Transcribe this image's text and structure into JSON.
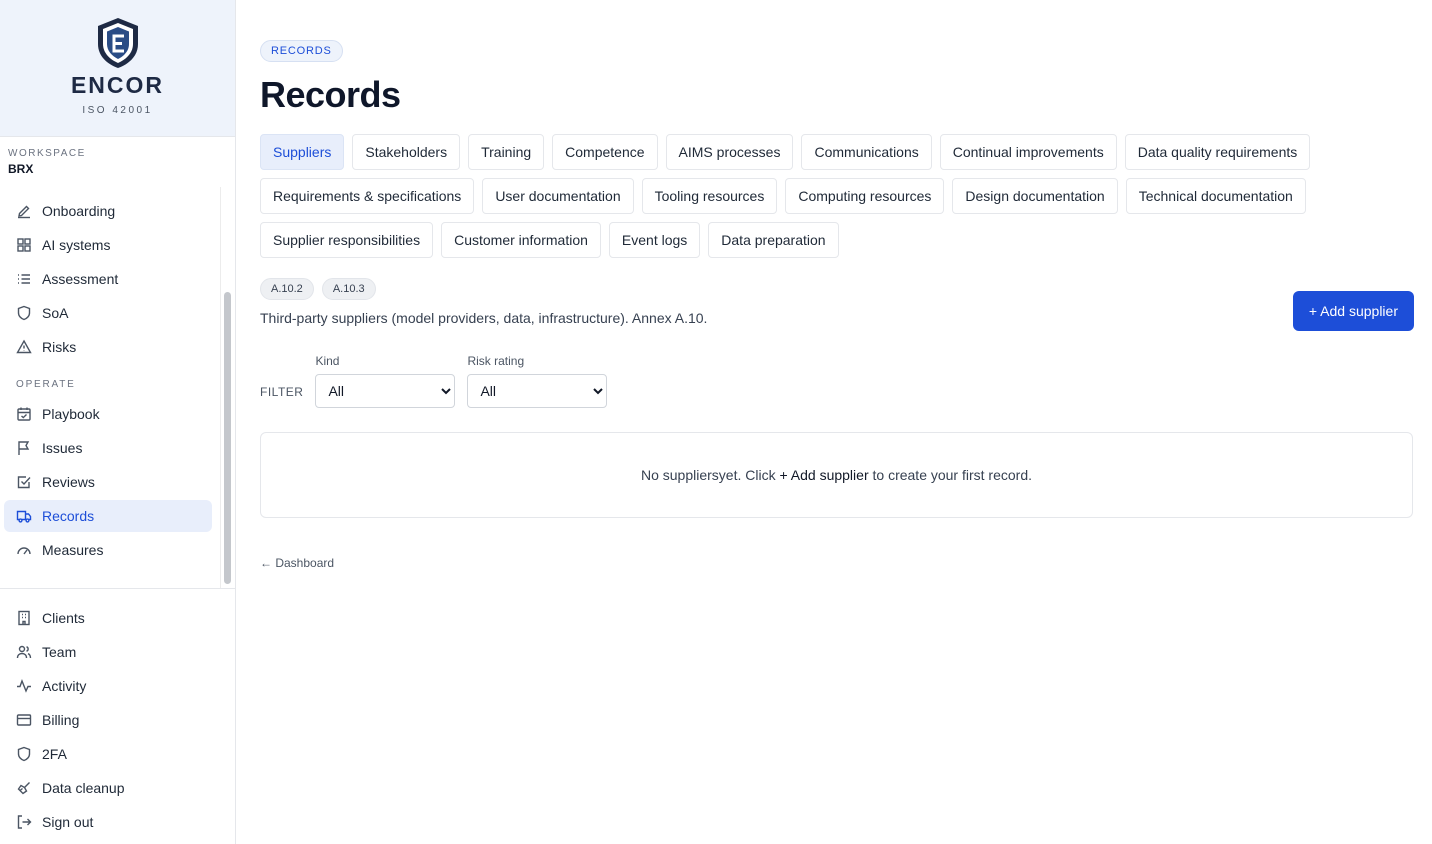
{
  "brand": {
    "name": "ENCOR",
    "subtitle": "ISO 42001"
  },
  "workspace": {
    "label": "WORKSPACE",
    "value": "BRX"
  },
  "sidebar": {
    "main_items": [
      {
        "label": "Onboarding",
        "icon": "pen-icon"
      },
      {
        "label": "AI systems",
        "icon": "grid-icon"
      },
      {
        "label": "Assessment",
        "icon": "list-icon"
      },
      {
        "label": "SoA",
        "icon": "shield-icon"
      },
      {
        "label": "Risks",
        "icon": "warning-icon"
      }
    ],
    "operate_label": "OPERATE",
    "operate_items": [
      {
        "label": "Playbook",
        "icon": "calendar-check-icon"
      },
      {
        "label": "Issues",
        "icon": "flag-icon"
      },
      {
        "label": "Reviews",
        "icon": "checkbox-icon"
      },
      {
        "label": "Records",
        "icon": "truck-icon",
        "active": true
      },
      {
        "label": "Measures",
        "icon": "gauge-icon"
      }
    ],
    "bottom_items": [
      {
        "label": "Clients",
        "icon": "building-icon"
      },
      {
        "label": "Team",
        "icon": "users-icon"
      },
      {
        "label": "Activity",
        "icon": "activity-icon"
      },
      {
        "label": "Billing",
        "icon": "credit-card-icon"
      },
      {
        "label": "2FA",
        "icon": "shield-icon"
      },
      {
        "label": "Data cleanup",
        "icon": "brush-icon"
      },
      {
        "label": "Sign out",
        "icon": "logout-icon"
      }
    ]
  },
  "page": {
    "pill": "RECORDS",
    "title": "Records"
  },
  "tabs": [
    "Suppliers",
    "Stakeholders",
    "Training",
    "Competence",
    "AIMS processes",
    "Communications",
    "Continual improvements",
    "Data quality requirements",
    "Requirements & specifications",
    "User documentation",
    "Tooling resources",
    "Computing resources",
    "Design documentation",
    "Technical documentation",
    "Supplier responsibilities",
    "Customer information",
    "Event logs",
    "Data preparation"
  ],
  "active_tab": "Suppliers",
  "codes": [
    "A.10.2",
    "A.10.3"
  ],
  "description": "Third-party suppliers (model providers, data, infrastructure). Annex A.10.",
  "add_button": "+ Add supplier",
  "filter": {
    "label": "FILTER",
    "kind_label": "Kind",
    "kind_value": "All",
    "risk_label": "Risk rating",
    "risk_value": "All"
  },
  "empty": {
    "prefix": "No suppliersyet. Click ",
    "link": "+ Add supplier",
    "suffix": " to create your first record."
  },
  "back_link": "← Dashboard",
  "colors": {
    "accent": "#1d4ed8",
    "brand_bg": "#eef3fb"
  }
}
